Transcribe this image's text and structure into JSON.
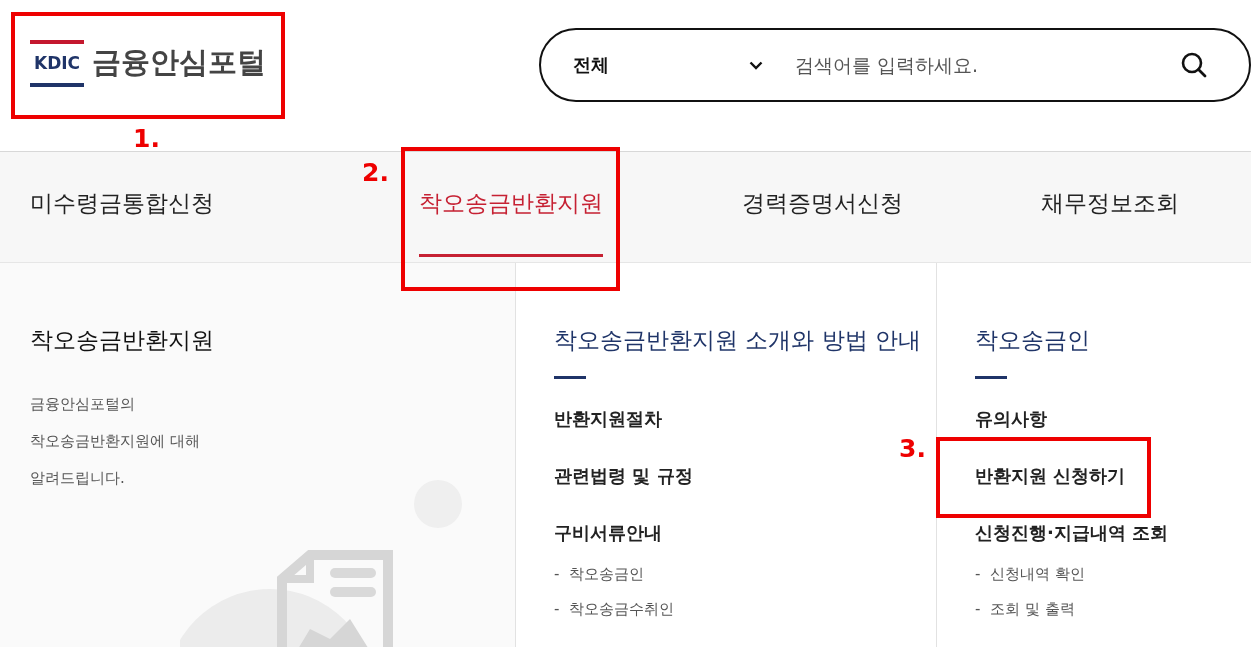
{
  "logo": {
    "mark": "KDIC",
    "text": "금융안심포털",
    "callout": "1."
  },
  "search": {
    "scope": "전체",
    "placeholder": "검색어를 입력하세요."
  },
  "tabs": [
    {
      "label": "미수령금통합신청",
      "selected": false
    },
    {
      "label": "착오송금반환지원",
      "selected": true,
      "callout": "2."
    },
    {
      "label": "경력증명서신청",
      "selected": false
    },
    {
      "label": "채무정보조회",
      "selected": false
    }
  ],
  "intro": {
    "title": "착오송금반환지원",
    "lines": [
      "금융안심포털의",
      "착오송금반환지원에 대해",
      "알려드립니다."
    ]
  },
  "columns": [
    {
      "heading": "착오송금반환지원 소개와 방법 안내",
      "items": [
        {
          "label": "반환지원절차"
        },
        {
          "label": "관련법령 및 규정"
        },
        {
          "label": "구비서류안내",
          "children": [
            {
              "bullet": "-",
              "label": "착오송금인"
            },
            {
              "bullet": "-",
              "label": "착오송금수취인"
            }
          ]
        }
      ]
    },
    {
      "heading": "착오송금인",
      "items": [
        {
          "label": "유의사항"
        },
        {
          "label": "반환지원 신청하기",
          "callout": "3."
        },
        {
          "label": "신청진행·지급내역 조회",
          "children": [
            {
              "bullet": "-",
              "label": "신청내역 확인"
            },
            {
              "bullet": "-",
              "label": "조회 및 출력"
            }
          ]
        }
      ]
    }
  ]
}
